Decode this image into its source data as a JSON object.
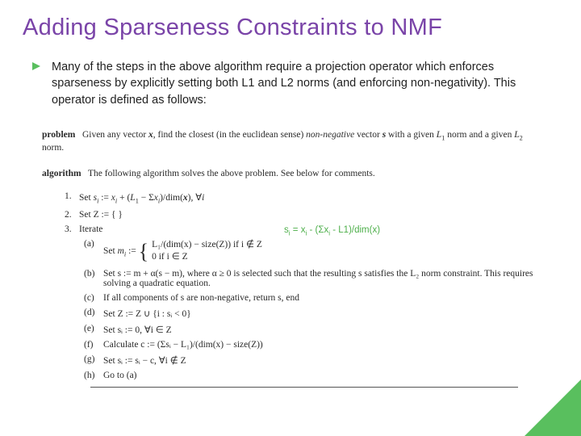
{
  "title": "Adding Sparseness Constraints to NMF",
  "bullet": "Many of the steps in the above algorithm require a projection operator which enforces sparseness by explicitly setting both L1 and L2 norms (and enforcing non-negativity). This operator is defined as follows:",
  "problem_label": "problem",
  "problem_text_a": "Given any vector ",
  "problem_x": "x",
  "problem_text_b": ", find the closest (in the euclidean sense) ",
  "problem_nn": "non-negative",
  "problem_text_c": " vector ",
  "problem_s": "s",
  "problem_text_d": " with a given ",
  "problem_L1a": "L",
  "problem_L1b": "1",
  "problem_text_e": " norm and a given ",
  "problem_L2a": "L",
  "problem_L2b": "2",
  "problem_text_f": " norm.",
  "algo_label": "algorithm",
  "algo_text": "The following algorithm solves the above problem. See below for comments.",
  "step1_pre": "Set ",
  "step1_si": "s",
  "step1_sub_i": "i",
  "step1_assign": " := ",
  "step1_xi": "x",
  "step1_plus": " + (",
  "step1_L1": "L",
  "step1_1": "1",
  "step1_minus": " − Σ",
  "step1_sumx": "x",
  "step1_sumsub": "i",
  "step1_close": ")/dim(",
  "step1_dimx": "x",
  "step1_end": "),   ∀",
  "step1_foralli": "i",
  "step2": "Set Z := { }",
  "step3": "Iterate",
  "annotation_lhs": "s",
  "annotation_sub1": "i",
  "annotation_eq": " = x",
  "annotation_sub2": "i",
  "annotation_rest": " - (Σx",
  "annotation_sub3": "i",
  "annotation_tail": " - L1)/dim(x)",
  "sub_a_pre": "Set ",
  "sub_a_mi": "m",
  "sub_a_sub": "i",
  "sub_a_assign": " := ",
  "sub_a_case1": "L₁/(dim(x) − size(Z))   if i ∉ Z",
  "sub_a_case2": "0                                  if i ∈ Z",
  "sub_b": "Set s := m + α(s − m), where α ≥ 0 is selected such that the resulting s satisfies the L₂ norm constraint. This requires solving a quadratic equation.",
  "sub_c": "If all components of s are non-negative, return s, end",
  "sub_d": "Set Z := Z ∪ {i : sᵢ < 0}",
  "sub_e": "Set sᵢ := 0,  ∀i ∈ Z",
  "sub_f": "Calculate c := (Σsᵢ − L₁)/(dim(x) − size(Z))",
  "sub_g": "Set sᵢ := sᵢ − c,  ∀i ∉ Z",
  "sub_h": "Go to (a)",
  "num1": "1.",
  "num2": "2.",
  "num3": "3.",
  "la": "(a)",
  "lb": "(b)",
  "lc": "(c)",
  "ld": "(d)",
  "le": "(e)",
  "lf": "(f)",
  "lg": "(g)",
  "lh": "(h)"
}
